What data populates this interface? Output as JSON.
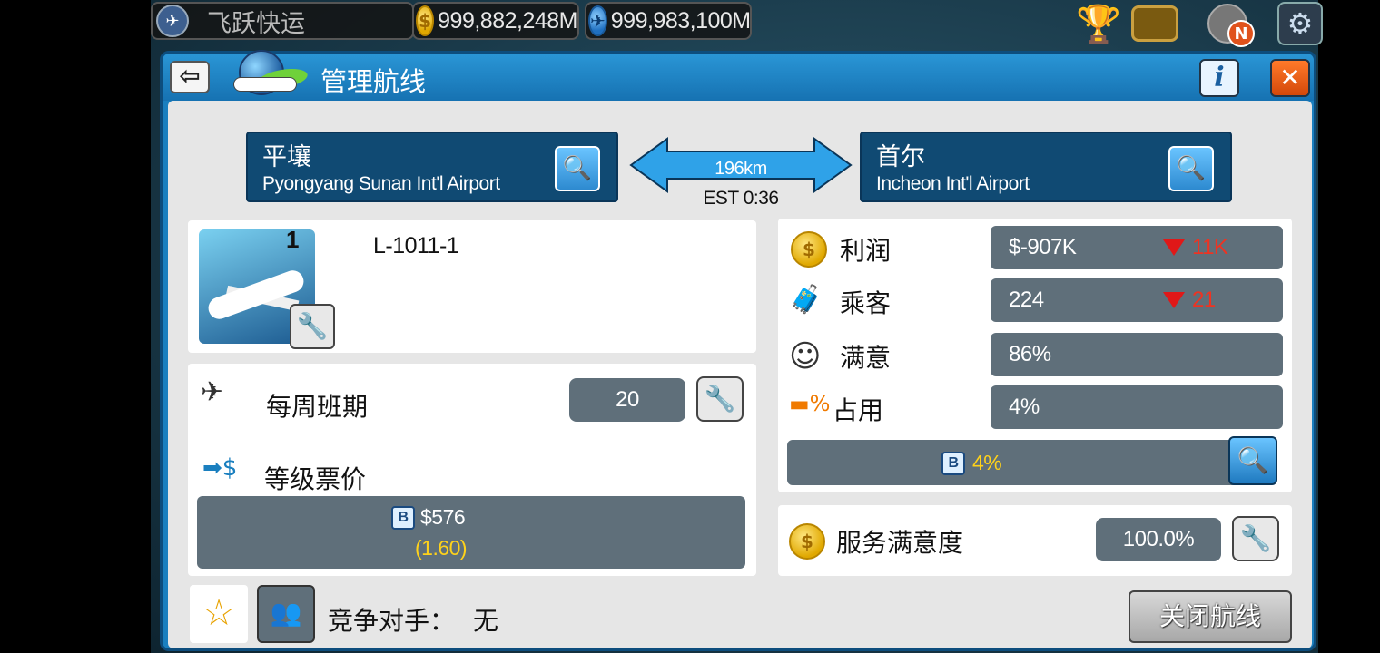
{
  "topbar": {
    "company_name": "飞跃快运",
    "cash": "999,882,248M",
    "bux": "999,983,100M",
    "notification_badge": "N"
  },
  "dialog": {
    "title": "管理航线"
  },
  "route": {
    "from": {
      "city": "平壤",
      "airport": "Pyongyang Sunan Int'l Airport"
    },
    "to": {
      "city": "首尔",
      "airport": "Incheon Int'l Airport"
    },
    "distance": "196km",
    "est": "EST 0:36"
  },
  "aircraft": {
    "count": "1",
    "model": "L-1011-1"
  },
  "schedule": {
    "weekly_label": "每周班期",
    "weekly_value": "20",
    "fare_label": "等级票价",
    "fare_class": "B",
    "fare_price": "$576",
    "fare_ratio": "(1.60)"
  },
  "stats": {
    "profit_label": "利润",
    "profit_value": "$-907K",
    "profit_delta": "11K",
    "passengers_label": "乘客",
    "passengers_value": "224",
    "passengers_delta": "21",
    "satisfaction_label": "满意",
    "satisfaction_value": "86%",
    "occupancy_label": "占用",
    "occupancy_value": "4%",
    "occupancy_class": "B",
    "occupancy_class_value": "4%"
  },
  "service": {
    "label": "服务满意度",
    "value": "100.0%"
  },
  "competition": {
    "label": "竞争对手：",
    "value": "无"
  },
  "close_route_label": "关闭航线",
  "colors": {
    "dialog_blue": "#1a7fbf",
    "airport_panel": "#104a73",
    "value_box": "#5f6f7a",
    "highlight_yellow": "#ffd21a",
    "decrease_red": "#e01818"
  }
}
